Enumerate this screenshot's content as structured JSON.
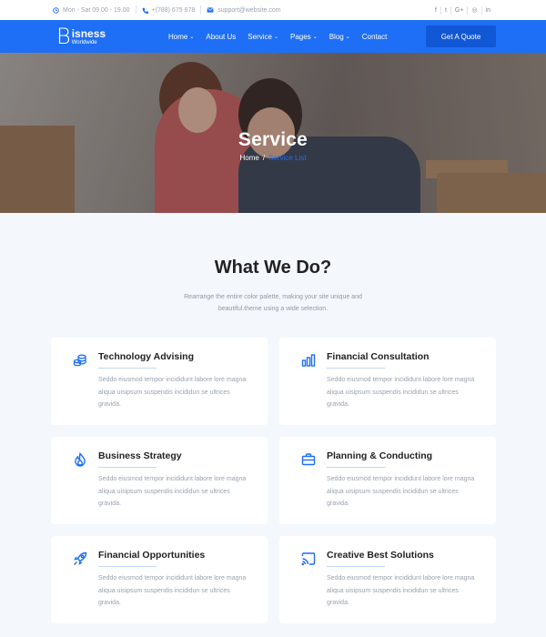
{
  "topbar": {
    "hours": "Mon - Sat 09.00 - 19.00",
    "phone": "+(788) 675 878",
    "email": "support@website.com",
    "social": [
      "f",
      "t",
      "G+",
      "◎",
      "in"
    ]
  },
  "nav": {
    "logo_letter": "B",
    "logo_word": "isness",
    "logo_tagline": "Worldwide",
    "items": [
      {
        "label": "Home",
        "has_dropdown": true
      },
      {
        "label": "About Us",
        "has_dropdown": false
      },
      {
        "label": "Service",
        "has_dropdown": true
      },
      {
        "label": "Pages",
        "has_dropdown": true
      },
      {
        "label": "Blog",
        "has_dropdown": true
      },
      {
        "label": "Contact",
        "has_dropdown": false
      }
    ],
    "cta": "Get A Quote"
  },
  "hero": {
    "title": "Service",
    "breadcrumb_home": "Home",
    "breadcrumb_sep": "/",
    "breadcrumb_current": "Service List"
  },
  "services": {
    "heading": "What We Do?",
    "subtitle": "Rearrange the entire color palette, making your site unique and beautiful.theme using a wide selection.",
    "cards": [
      {
        "title": "Technology Advising",
        "icon": "coins-icon",
        "text": "Seddo eiusmod tempor incididunt labore lore magna aliqua uisipsum suspendis incididun se ultrices gravida."
      },
      {
        "title": "Financial Consultation",
        "icon": "bar-chart-icon",
        "text": "Seddo eiusmod tempor incididunt labore lore magna aliqua uisipsum suspendis incididun se ultrices gravida."
      },
      {
        "title": "Business Strategy",
        "icon": "flame-icon",
        "text": "Seddo eiusmod tempor incididunt labore lore magna aliqua uisipsum suspendis incididun se ultrices gravida."
      },
      {
        "title": "Planning & Conducting",
        "icon": "briefcase-icon",
        "text": "Seddo eiusmod tempor incididunt labore lore magna aliqua uisipsum suspendis incididun se ultrices gravida."
      },
      {
        "title": "Financial Opportunities",
        "icon": "rocket-icon",
        "text": "Seddo eiusmod tempor incididunt labore lore magna aliqua uisipsum suspendis incididun se ultrices gravida."
      },
      {
        "title": "Creative Best Solutions",
        "icon": "cast-icon",
        "text": "Seddo eiusmod tempor incididunt labore lore magna aliqua uisipsum suspendis incididun se ultrices gravida."
      }
    ]
  },
  "colors": {
    "primary": "#1e6ff5",
    "background": "#f4f8fd",
    "card": "#ffffff"
  }
}
